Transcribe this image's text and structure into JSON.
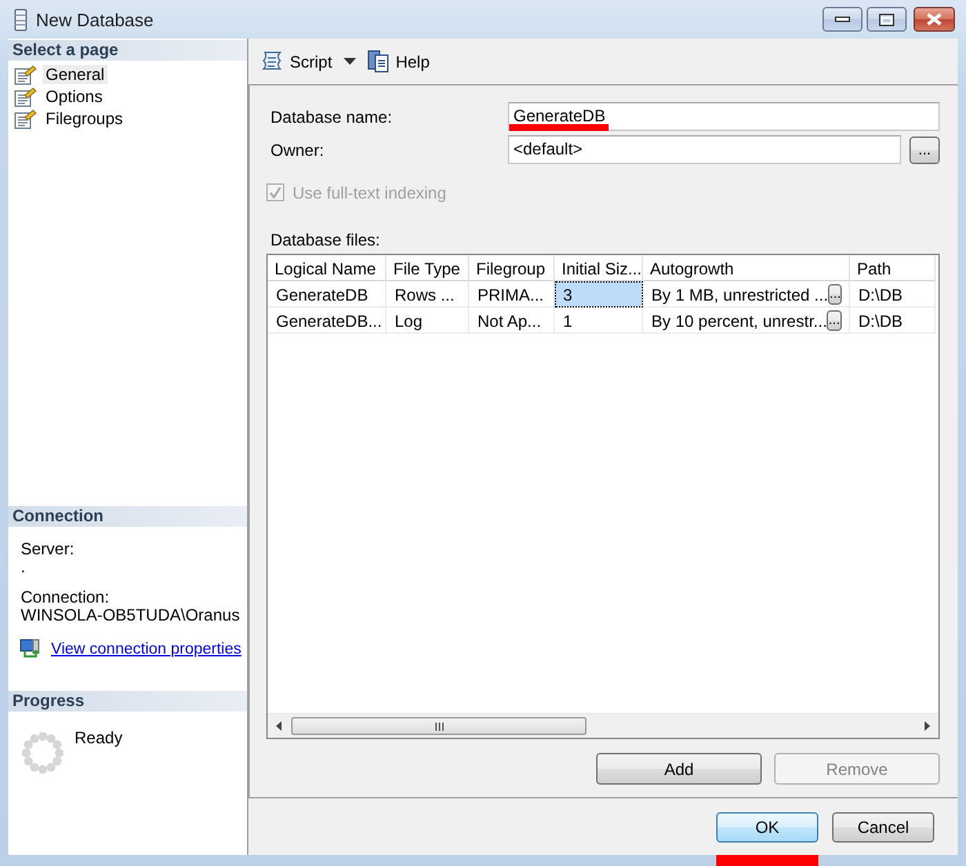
{
  "window": {
    "title": "New Database"
  },
  "sidebar": {
    "header": "Select a page",
    "pages": [
      {
        "label": "General",
        "selected": true
      },
      {
        "label": "Options",
        "selected": false
      },
      {
        "label": "Filegroups",
        "selected": false
      }
    ]
  },
  "connection": {
    "header": "Connection",
    "server_label": "Server:",
    "server": ".",
    "connection_label": "Connection:",
    "connection": "WINSOLA-OB5TUDA\\Oranus",
    "link": "View connection properties"
  },
  "progress": {
    "header": "Progress",
    "status": "Ready"
  },
  "toolbar": [
    {
      "label": "Script",
      "kind": "dropdown"
    },
    {
      "label": "Help",
      "kind": "button"
    }
  ],
  "form": {
    "database_name": {
      "label": "Database name:",
      "value": "GenerateDB",
      "underlined": true
    },
    "owner": {
      "label": "Owner:",
      "value": "<default>",
      "button": "..."
    },
    "full_text": {
      "label": "Use full-text indexing",
      "checked": true,
      "disabled": true
    }
  },
  "files": {
    "label": "Database files:",
    "columns": [
      "Logical Name",
      "File Type",
      "Filegroup",
      "Initial Siz...",
      "Autogrowth",
      "Path"
    ],
    "rows": [
      {
        "cells": [
          {
            "text": "GenerateDB",
            "selected": false
          },
          {
            "text": "Rows ...",
            "selected": false
          },
          {
            "text": "PRIMA...",
            "selected": false
          },
          {
            "text": "3",
            "selected": true
          },
          {
            "text": "By 1 MB, unrestricted ...",
            "selected": false,
            "button": "..."
          },
          {
            "text": "D:\\DB",
            "selected": false
          }
        ]
      },
      {
        "cells": [
          {
            "text": "GenerateDB...",
            "selected": false
          },
          {
            "text": "Log",
            "selected": false
          },
          {
            "text": "Not Ap...",
            "selected": false
          },
          {
            "text": "1",
            "selected": false
          },
          {
            "text": "By 10 percent, unrestr...",
            "selected": false,
            "button": "..."
          },
          {
            "text": "D:\\DB",
            "selected": false
          }
        ]
      }
    ]
  },
  "file_buttons": [
    {
      "label": "Add",
      "disabled": false
    },
    {
      "label": "Remove",
      "disabled": true
    }
  ],
  "footer": [
    {
      "label": "OK",
      "default": true,
      "underlined": true
    },
    {
      "label": "Cancel",
      "default": false,
      "underlined": false
    }
  ]
}
